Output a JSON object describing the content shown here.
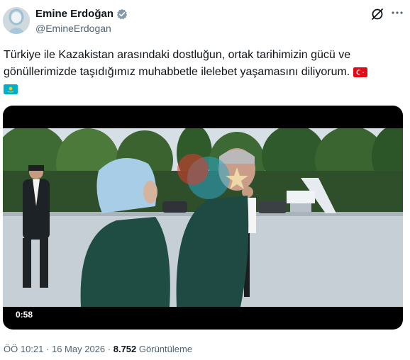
{
  "author": {
    "name": "Emine Erdoğan",
    "handle": "@EmineErdogan"
  },
  "tweet": {
    "text": "Türkiye ile Kazakistan arasındaki dostluğun, ortak tarihimizin gücü ve gönüllerimizde taşıdığımız muhabbetle ilelebet yaşamasını diliyorum."
  },
  "media": {
    "duration": "0:58"
  },
  "meta": {
    "time": "ÖÖ 10:21",
    "separator": "·",
    "date": "16 May 2026",
    "views_count": "8.752",
    "views_label": "Görüntüleme"
  },
  "colors": {
    "accent": "#1d9bf0",
    "text_primary": "#0f1419",
    "text_secondary": "#536471",
    "turkey_red": "#e30a17",
    "kazakh_blue": "#00afca"
  },
  "icons": {
    "verified": "verified-badge-icon",
    "grok": "grok-icon",
    "more": "more-icon",
    "flag_tr": "turkey-flag-icon",
    "flag_kz": "kazakhstan-flag-icon"
  }
}
